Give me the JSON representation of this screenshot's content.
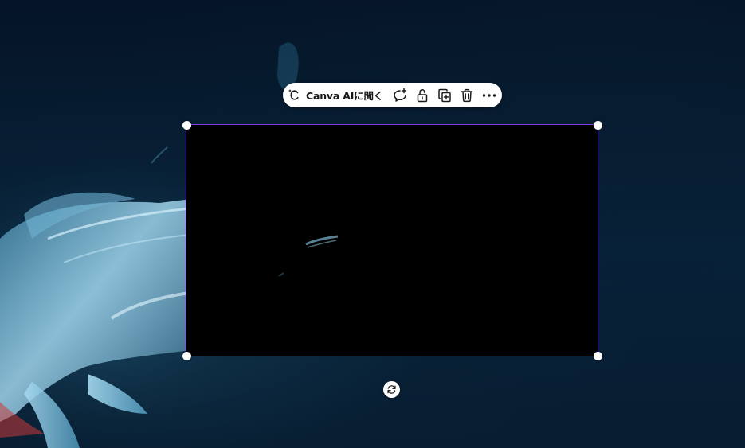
{
  "toolbar": {
    "ai_label": "Canva AIに聞く",
    "ai_icon": "canva-ai-sparkle-icon",
    "buttons": [
      {
        "icon": "comment-add-icon"
      },
      {
        "icon": "unlock-icon"
      },
      {
        "icon": "duplicate-icon"
      },
      {
        "icon": "trash-icon"
      },
      {
        "icon": "more-horizontal-icon"
      }
    ]
  },
  "selection": {
    "content": "black-video-frame",
    "border_color": "#7b3fe4"
  },
  "colors": {
    "background": "#06182a",
    "selection_border": "#7b3fe4",
    "toolbar_bg": "#ffffff"
  },
  "rotate_handle": {
    "icon": "rotate-icon"
  }
}
